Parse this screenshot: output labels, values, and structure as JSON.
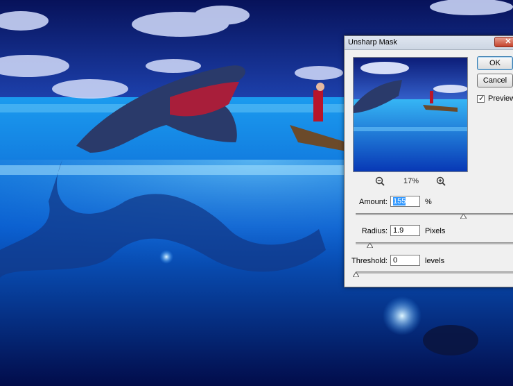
{
  "dialog": {
    "title": "Unsharp Mask",
    "close_icon": "close-icon",
    "ok_label": "OK",
    "cancel_label": "Cancel",
    "preview_label": "Preview",
    "preview_checked": true,
    "zoom_value": "17%",
    "zoom_out_icon": "zoom-out-icon",
    "zoom_in_icon": "zoom-in-icon",
    "amount": {
      "label": "Amount:",
      "value": "155",
      "unit": "%",
      "slider_fraction": 0.67
    },
    "radius": {
      "label": "Radius:",
      "value": "1.9",
      "unit": "Pixels",
      "slider_fraction": 0.09
    },
    "threshold": {
      "label": "Threshold:",
      "value": "0",
      "unit": "levels",
      "slider_fraction": 0.0
    }
  },
  "colors": {
    "dialog_bg": "#f0f0f0",
    "close_red": "#c4422c",
    "selection_blue": "#3399ff",
    "sky_blue": "#1a3fb0",
    "ocean_blue": "#0a6fd8"
  }
}
